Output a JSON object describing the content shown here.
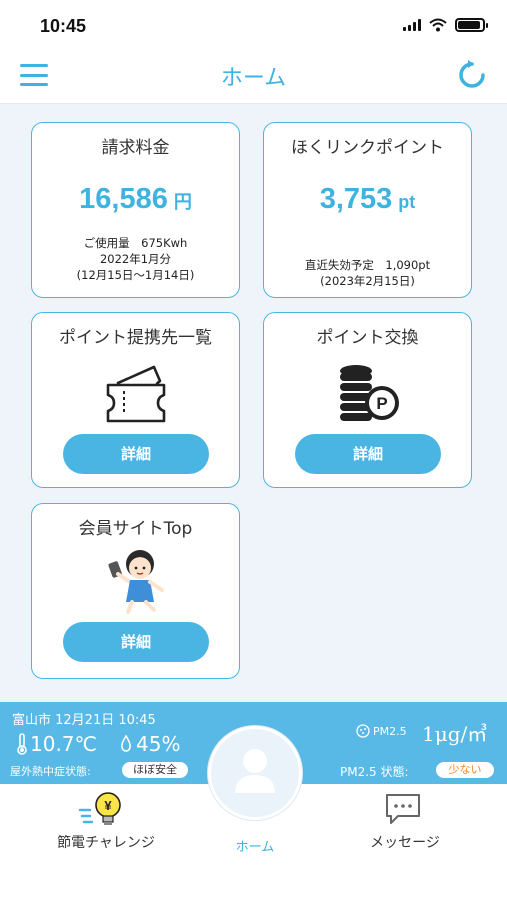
{
  "status": {
    "time": "10:45"
  },
  "header": {
    "title": "ホーム"
  },
  "billing": {
    "title": "請求料金",
    "amount": "16,586",
    "unit": "円",
    "usage": "ご使用量　675Kwh",
    "month": "2022年1月分",
    "period": "(12月15日～1月14日)"
  },
  "points": {
    "title": "ほくリンクポイント",
    "amount": "3,753",
    "unit": "pt",
    "expiry": "直近失効予定　1,090pt",
    "expiry_date": "(2023年2月15日)"
  },
  "partners": {
    "title": "ポイント提携先一覧",
    "button": "詳細"
  },
  "exchange": {
    "title": "ポイント交換",
    "button": "詳細",
    "coin_letter": "P"
  },
  "member": {
    "title": "会員サイトTop",
    "button": "詳細"
  },
  "weather": {
    "location": "富山市 12月21日 10:45",
    "temperature": "10.7℃",
    "humidity": "45%",
    "heat_label": "屋外熱中症状態:",
    "heat_status": "ほぼ安全",
    "pm_small": "PM2.5",
    "pm_value": "1μg/㎥",
    "pm_label": "PM2.5 状態:",
    "pm_status": "少ない"
  },
  "tabs": {
    "left": "節電チャレンジ",
    "center": "ホーム",
    "right": "メッセージ",
    "left_icon_symbol": "¥"
  },
  "colors": {
    "accent": "#3eb3e0",
    "button": "#4ab5e3",
    "weather_bg": "#58b8e6",
    "pm_status": "#f08a24"
  }
}
